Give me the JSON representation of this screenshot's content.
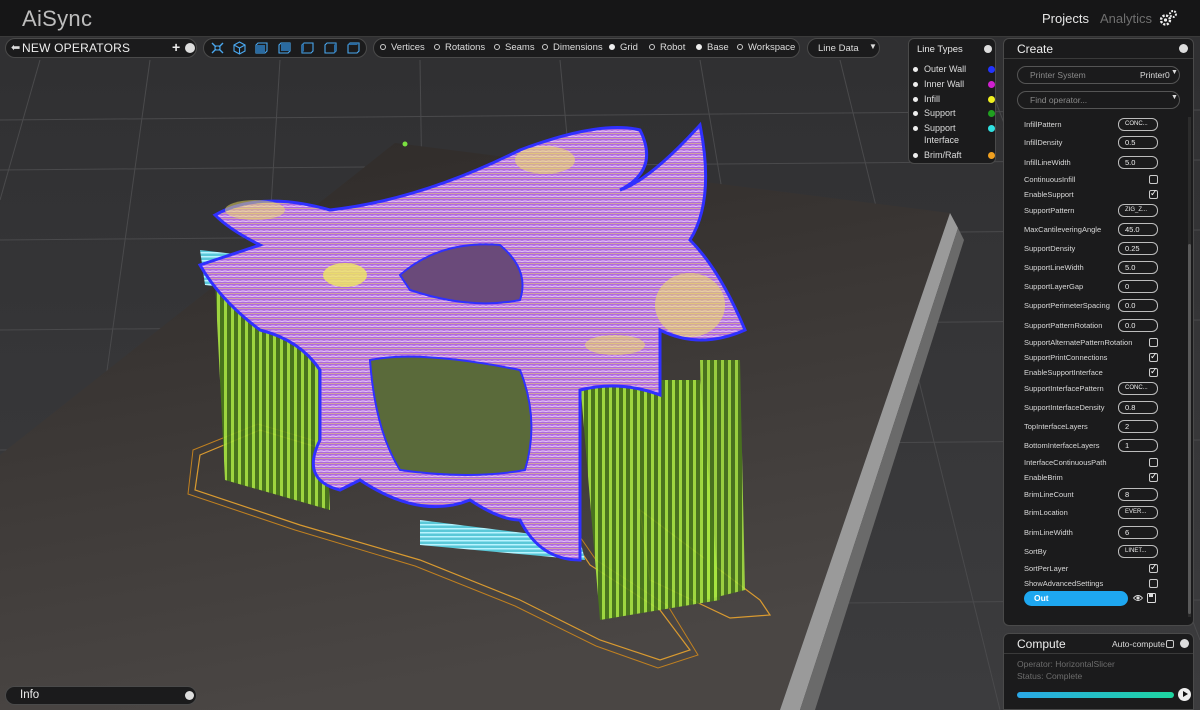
{
  "app": {
    "title": "AiSync"
  },
  "nav": {
    "projects": "Projects",
    "analytics": "Analytics",
    "settings_icon": "gears-icon"
  },
  "operators": {
    "label": "NEW OPERATORS",
    "add": "+"
  },
  "view_toggles": [
    {
      "label": "Vertices",
      "on": false
    },
    {
      "label": "Rotations",
      "on": false
    },
    {
      "label": "Seams",
      "on": false
    },
    {
      "label": "Dimensions",
      "on": false
    },
    {
      "label": "Grid",
      "on": true
    },
    {
      "label": "Robot",
      "on": false
    },
    {
      "label": "Base",
      "on": true
    },
    {
      "label": "Workspace",
      "on": false
    }
  ],
  "line_data": {
    "label": "Line Data"
  },
  "line_types": {
    "title": "Line Types",
    "items": [
      {
        "label": "Outer Wall",
        "color": "#2233ff"
      },
      {
        "label": "Inner Wall",
        "color": "#d020d0"
      },
      {
        "label": "Infill",
        "color": "#f0f020"
      },
      {
        "label": "Support",
        "color": "#20a020"
      },
      {
        "label": "Support Interface",
        "color": "#30e0e0"
      },
      {
        "label": "Brim/Raft",
        "color": "#f0a020"
      }
    ]
  },
  "create": {
    "title": "Create",
    "printer_system_label": "Printer System",
    "printer_system_value": "Printer0",
    "find_placeholder": "Find operator...",
    "params": [
      {
        "name": "InfillPattern",
        "type": "input",
        "value": "CONC..."
      },
      {
        "name": "InfillDensity",
        "type": "input",
        "value": "0.5"
      },
      {
        "name": "InfillLineWidth",
        "type": "input",
        "value": "5.0"
      },
      {
        "name": "ContinuousInfill",
        "type": "check",
        "checked": false
      },
      {
        "name": "EnableSupport",
        "type": "check",
        "checked": true
      },
      {
        "name": "SupportPattern",
        "type": "input",
        "value": "ZIG_Z..."
      },
      {
        "name": "MaxCantileveringAngle",
        "type": "input",
        "value": "45.0"
      },
      {
        "name": "SupportDensity",
        "type": "input",
        "value": "0.25"
      },
      {
        "name": "SupportLineWidth",
        "type": "input",
        "value": "5.0"
      },
      {
        "name": "SupportLayerGap",
        "type": "input",
        "value": "0"
      },
      {
        "name": "SupportPerimeterSpacing",
        "type": "input",
        "value": "0.0"
      },
      {
        "name": "SupportPatternRotation",
        "type": "input",
        "value": "0.0"
      },
      {
        "name": "SupportAlternatePatternRotation",
        "type": "check",
        "checked": false
      },
      {
        "name": "SupportPrintConnections",
        "type": "check",
        "checked": true
      },
      {
        "name": "EnableSupportInterface",
        "type": "check",
        "checked": true
      },
      {
        "name": "SupportInterfacePattern",
        "type": "input",
        "value": "CONC..."
      },
      {
        "name": "SupportInterfaceDensity",
        "type": "input",
        "value": "0.8"
      },
      {
        "name": "TopInterfaceLayers",
        "type": "input",
        "value": "2"
      },
      {
        "name": "BottomInterfaceLayers",
        "type": "input",
        "value": "1"
      },
      {
        "name": "InterfaceContinuousPath",
        "type": "check",
        "checked": false
      },
      {
        "name": "EnableBrim",
        "type": "check",
        "checked": true
      },
      {
        "name": "BrimLineCount",
        "type": "input",
        "value": "8"
      },
      {
        "name": "BrimLocation",
        "type": "input",
        "value": "EVER..."
      },
      {
        "name": "BrimLineWidth",
        "type": "input",
        "value": "6"
      },
      {
        "name": "SortBy",
        "type": "input",
        "value": "LINET..."
      },
      {
        "name": "SortPerLayer",
        "type": "check",
        "checked": true
      },
      {
        "name": "ShowAdvancedSettings",
        "type": "check",
        "checked": false
      }
    ],
    "output_button": "Out"
  },
  "compute": {
    "title": "Compute",
    "auto_compute_label": "Auto-compute",
    "operator_text": "Operator: HorizontalSlicer",
    "status_text": "Status: Complete",
    "progress": 1.0
  },
  "info": {
    "label": "Info"
  }
}
